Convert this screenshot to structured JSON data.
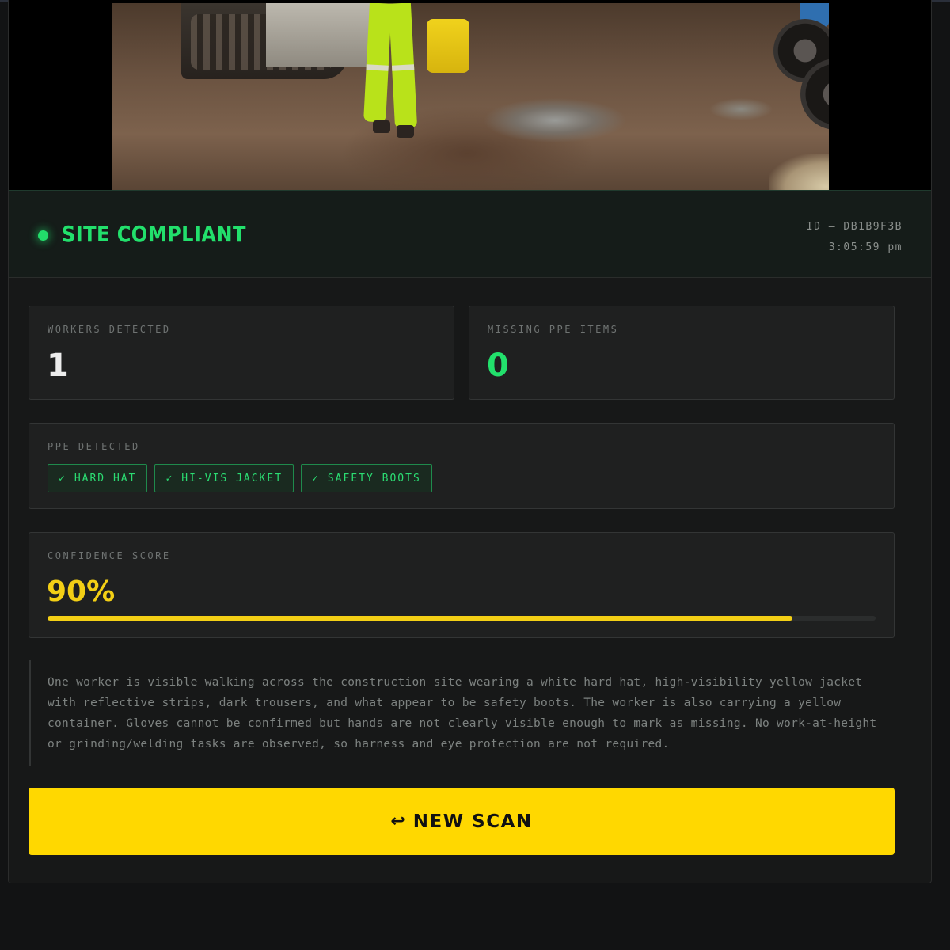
{
  "status": {
    "label": "SITE COMPLIANT",
    "color": "#22e06c",
    "scan_id": "ID — DB1B9F3B",
    "time": "3:05:59 pm"
  },
  "stats": {
    "workers_label": "WORKERS DETECTED",
    "workers_value": "1",
    "missing_label": "MISSING PPE ITEMS",
    "missing_value": "0"
  },
  "ppe": {
    "label": "PPE DETECTED",
    "items": [
      {
        "check": "✓",
        "label": "HARD HAT"
      },
      {
        "check": "✓",
        "label": "HI-VIS JACKET"
      },
      {
        "check": "✓",
        "label": "SAFETY BOOTS"
      }
    ]
  },
  "confidence": {
    "label": "CONFIDENCE SCORE",
    "value_text": "90%",
    "value": 0.9,
    "color": "#f3cf15"
  },
  "analysis": {
    "text": "One worker is visible walking across the construction site wearing a white hard hat, high-visibility yellow jacket with reflective strips, dark trousers, and what appear to be safety boots. The worker is also carrying a yellow container. Gloves cannot be confirmed but hands are not clearly visible enough to mark as missing. No work-at-height or grinding/welding tasks are observed, so harness and eye protection are not required."
  },
  "actions": {
    "new_scan_icon": "return-arrow-icon",
    "new_scan_glyph": "↩",
    "new_scan_label": "NEW SCAN",
    "accent": "#ffd800"
  }
}
